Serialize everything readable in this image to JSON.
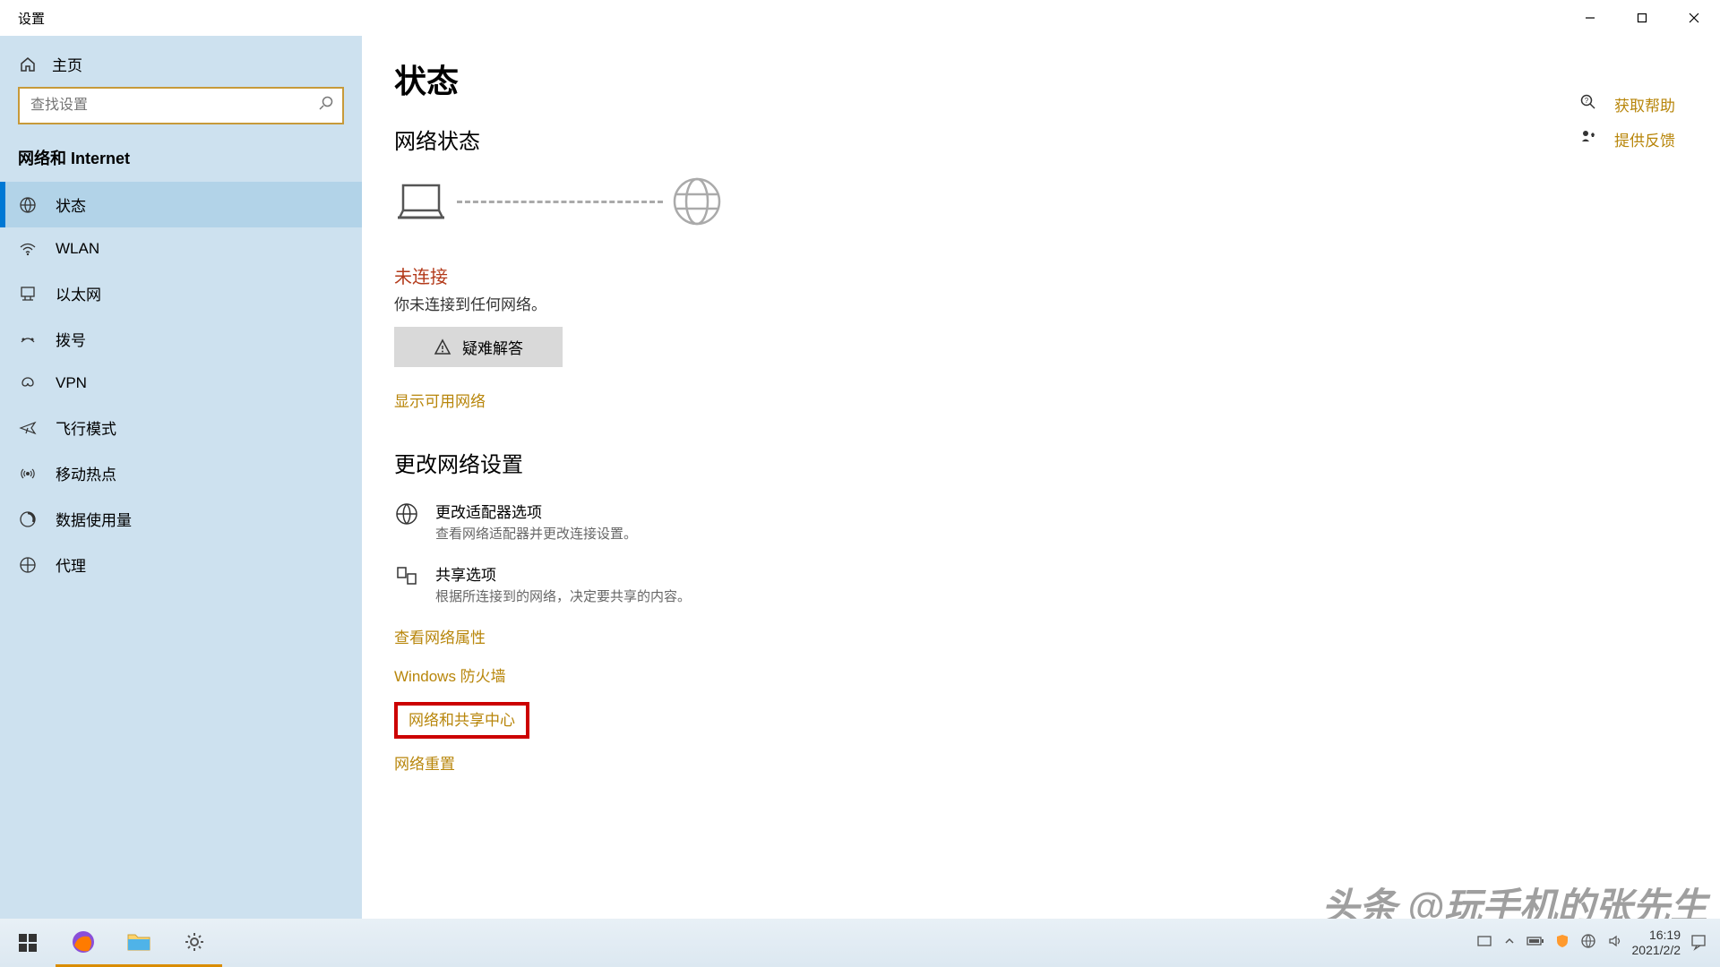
{
  "window": {
    "title": "设置"
  },
  "sidebar": {
    "home_label": "主页",
    "search_placeholder": "查找设置",
    "group_title": "网络和 Internet",
    "items": [
      {
        "label": "状态"
      },
      {
        "label": "WLAN"
      },
      {
        "label": "以太网"
      },
      {
        "label": "拨号"
      },
      {
        "label": "VPN"
      },
      {
        "label": "飞行模式"
      },
      {
        "label": "移动热点"
      },
      {
        "label": "数据使用量"
      },
      {
        "label": "代理"
      }
    ]
  },
  "content": {
    "page_title": "状态",
    "section_network_status": "网络状态",
    "not_connected": "未连接",
    "not_connected_desc": "你未连接到任何网络。",
    "troubleshoot": "疑难解答",
    "show_networks": "显示可用网络",
    "section_change": "更改网络设置",
    "adapter_title": "更改适配器选项",
    "adapter_desc": "查看网络适配器并更改连接设置。",
    "sharing_title": "共享选项",
    "sharing_desc": "根据所连接到的网络，决定要共享的内容。",
    "view_props": "查看网络属性",
    "firewall": "Windows 防火墙",
    "sharing_center": "网络和共享中心",
    "reset": "网络重置"
  },
  "help": {
    "get_help": "获取帮助",
    "feedback": "提供反馈"
  },
  "taskbar": {
    "time": "16:19",
    "date": "2021/2/2"
  },
  "watermark": "头条 @玩手机的张先生"
}
